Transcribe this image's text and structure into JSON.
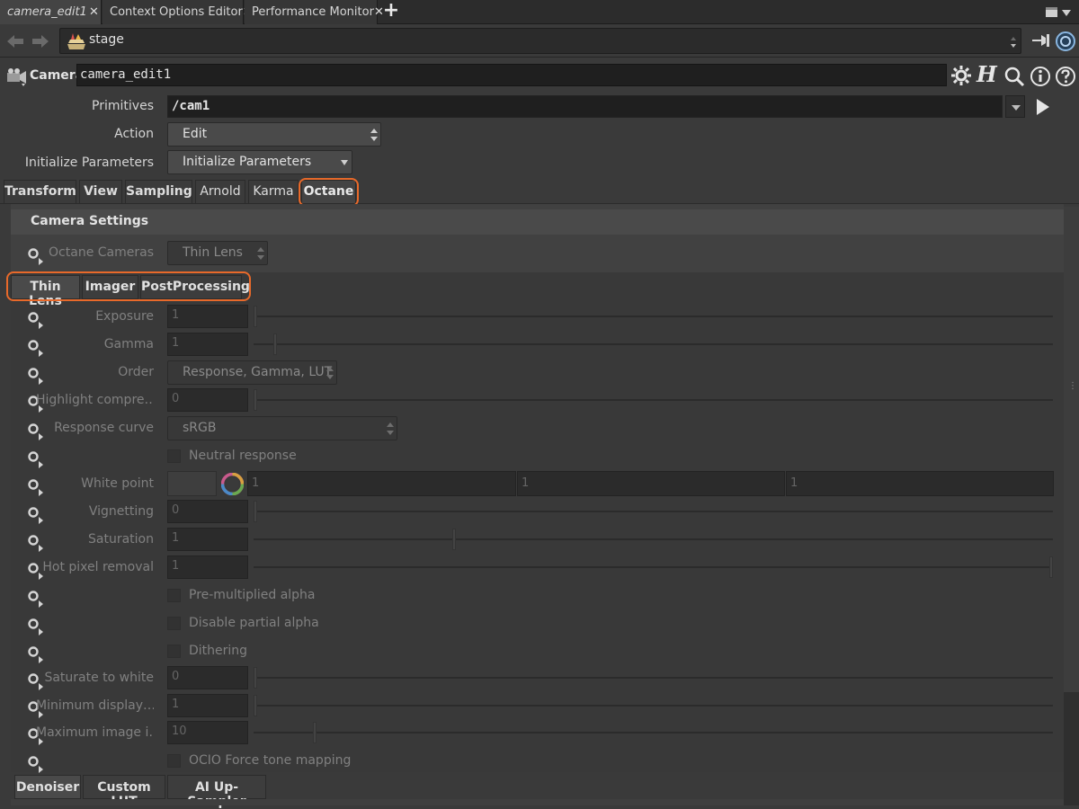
{
  "tabs": [
    {
      "label": "camera_edit1",
      "active": true
    },
    {
      "label": "Context Options Editor"
    },
    {
      "label": "Performance Monitor"
    }
  ],
  "pathbar": {
    "path": "stage"
  },
  "node": {
    "type": "Camera",
    "name": "camera_edit1"
  },
  "params": {
    "primitives": {
      "label": "Primitives",
      "value": "/cam1"
    },
    "action": {
      "label": "Action",
      "value": "Edit"
    },
    "init": {
      "label": "Initialize Parameters",
      "value": "Initialize Parameters"
    }
  },
  "folder_tabs": [
    "Transform",
    "View",
    "Sampling",
    "Arnold",
    "Karma",
    "Octane"
  ],
  "camera_settings": {
    "title": "Camera Settings",
    "octane_cameras": {
      "label": "Octane Cameras",
      "value": "Thin Lens"
    }
  },
  "sub_tabs": [
    "Thin Lens",
    "Imager",
    "PostProcessing"
  ],
  "imager": {
    "exposure": {
      "label": "Exposure",
      "value": "1"
    },
    "gamma": {
      "label": "Gamma",
      "value": "1"
    },
    "order": {
      "label": "Order",
      "value": "Response, Gamma, LUT"
    },
    "highlight": {
      "label": "Highlight compre…",
      "value": "0"
    },
    "response_curve": {
      "label": "Response curve",
      "value": "sRGB"
    },
    "neutral_response": {
      "label": "Neutral response"
    },
    "white_point": {
      "label": "White point",
      "r": "1",
      "g": "1",
      "b": "1"
    },
    "vignetting": {
      "label": "Vignetting",
      "value": "0"
    },
    "saturation": {
      "label": "Saturation",
      "value": "1"
    },
    "hot_pixel": {
      "label": "Hot pixel removal",
      "value": "1"
    },
    "premult_alpha": {
      "label": "Pre-multiplied alpha"
    },
    "disable_partial_alpha": {
      "label": "Disable partial alpha"
    },
    "dithering": {
      "label": "Dithering"
    },
    "saturate_white": {
      "label": "Saturate to white",
      "value": "0"
    },
    "min_display": {
      "label": "Minimum display…",
      "value": "1"
    },
    "max_image": {
      "label": "Maximum image i…",
      "value": "10"
    },
    "ocio_force": {
      "label": "OCIO Force tone mapping"
    }
  },
  "bottom_tabs": [
    "Denoiser",
    "Custom LUT",
    "AI Up-Sampler"
  ],
  "slider_levels": {
    "exposure": 0.0,
    "gamma": 0.025,
    "highlight": 0.0,
    "vignetting": 0.0,
    "saturation": 0.25,
    "hot_pixel": 1.0,
    "saturate_white": 0.0,
    "min_display": 0.0,
    "max_image": 0.075
  },
  "colors": {
    "highlight": "#e8692a",
    "background": "#3a3a3a"
  }
}
